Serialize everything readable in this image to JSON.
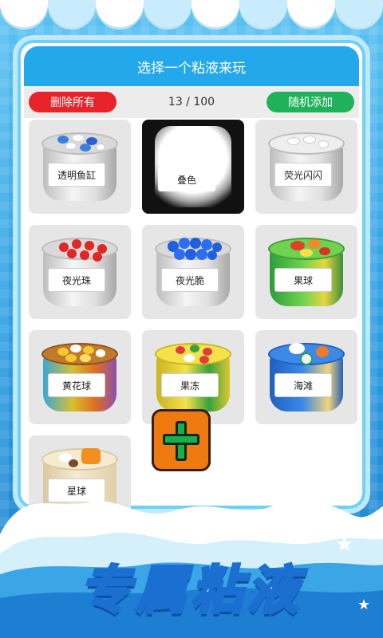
{
  "header": {
    "title": "选择一个粘液来玩"
  },
  "toolbar": {
    "delete_all_label": "删除所有",
    "counter": "13 / 100",
    "random_add_label": "随机添加"
  },
  "slimes": [
    {
      "label": "透明鱼缸"
    },
    {
      "label": "叠色"
    },
    {
      "label": "荧光闪闪"
    },
    {
      "label": "夜光珠"
    },
    {
      "label": "夜光脆"
    },
    {
      "label": "果球"
    },
    {
      "label": "黄花球"
    },
    {
      "label": "果冻"
    },
    {
      "label": "海滩"
    },
    {
      "label": "星球"
    }
  ],
  "banner": {
    "text": "专属粘液"
  },
  "colors": {
    "title_bar": "#23a8ec",
    "delete_button": "#e8232a",
    "random_button": "#1fb25a",
    "add_button": "#ef7a12",
    "plus_sign": "#18b04a"
  },
  "icons": {
    "add": "plus-icon"
  }
}
